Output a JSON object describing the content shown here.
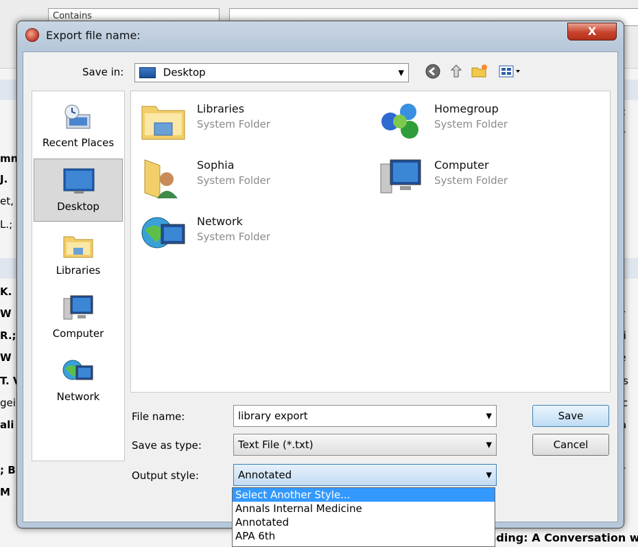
{
  "background": {
    "combo_label": "Contains",
    "left_fragments": [
      "mn",
      "J.",
      "et,",
      "L.;",
      "K.",
      "W",
      "R.;",
      "W",
      "T. V",
      "gei",
      "ali",
      "; B",
      "M"
    ],
    "right_fragments": [
      "lec",
      "ter",
      "ski",
      "n f",
      "tly",
      "o f",
      "tor",
      "opi",
      "ele",
      "al s",
      "sec",
      "e a",
      "le",
      "err",
      "be",
      "ire"
    ],
    "bottom_text": "nding: A Conversation w"
  },
  "dialog": {
    "title": "Export file name:",
    "close_label": "X",
    "save_in": {
      "label": "Save in:",
      "value": "Desktop"
    },
    "places": [
      {
        "label": "Recent Places",
        "icon": "recent-places-icon",
        "selected": false
      },
      {
        "label": "Desktop",
        "icon": "desktop-icon",
        "selected": true
      },
      {
        "label": "Libraries",
        "icon": "libraries-icon",
        "selected": false
      },
      {
        "label": "Computer",
        "icon": "computer-icon",
        "selected": false
      },
      {
        "label": "Network",
        "icon": "network-icon",
        "selected": false
      }
    ],
    "files": [
      {
        "name": "Libraries",
        "type": "System Folder",
        "icon": "libraries-folder-icon"
      },
      {
        "name": "Homegroup",
        "type": "System Folder",
        "icon": "homegroup-icon"
      },
      {
        "name": "Sophia",
        "type": "System Folder",
        "icon": "user-folder-icon"
      },
      {
        "name": "Computer",
        "type": "System Folder",
        "icon": "computer-icon"
      },
      {
        "name": "Network",
        "type": "System Folder",
        "icon": "network-icon"
      }
    ],
    "file_name": {
      "label": "File name:",
      "value": "library export"
    },
    "save_as_type": {
      "label": "Save as type:",
      "value": "Text File (*.txt)"
    },
    "output_style": {
      "label": "Output style:",
      "value": "Annotated",
      "options": [
        "Select Another Style...",
        "Annals Internal Medicine",
        "Annotated",
        "APA 6th"
      ]
    },
    "buttons": {
      "save": "Save",
      "cancel": "Cancel"
    }
  }
}
